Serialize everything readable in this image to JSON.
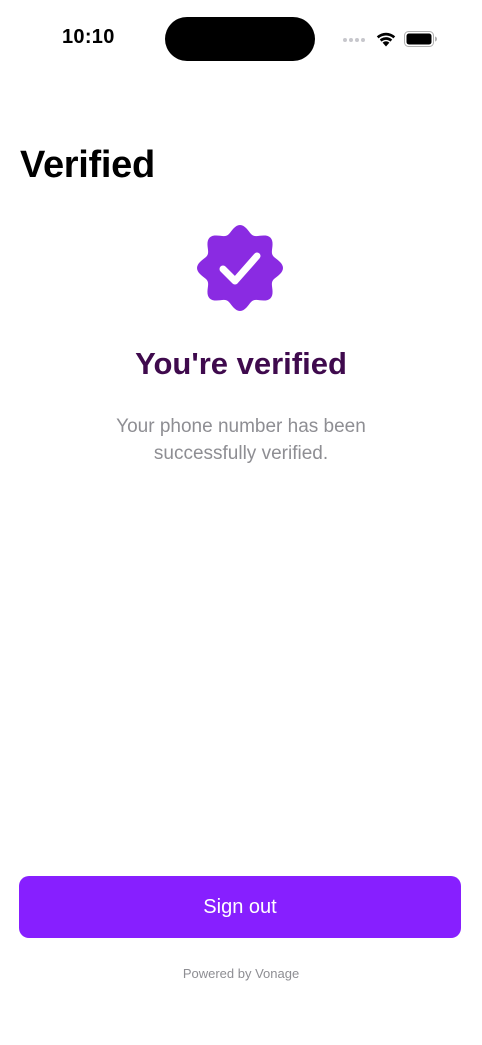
{
  "status_bar": {
    "time": "10:10"
  },
  "page": {
    "title": "Verified"
  },
  "badge": {
    "icon": "verified-badge-checkmark-icon",
    "color": "#8a2be2"
  },
  "content": {
    "headline": "You're verified",
    "message": "Your phone number has been successfully verified."
  },
  "actions": {
    "sign_out_label": "Sign out",
    "button_color": "#871fff"
  },
  "footer": {
    "powered_by": "Powered by Vonage"
  }
}
